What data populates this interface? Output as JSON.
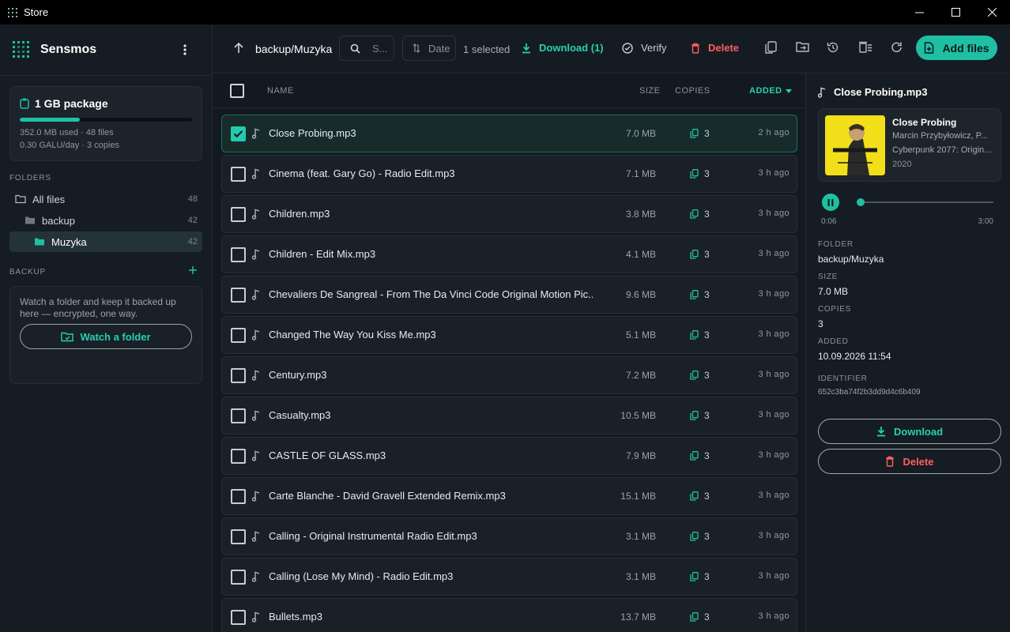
{
  "window": {
    "title": "Store"
  },
  "brand": {
    "name": "Sensmos"
  },
  "package": {
    "title": "1 GB package",
    "usage_fraction": 0.35,
    "usage_text": "352.0 MB used · 48 files",
    "rate_text": "0.30 GALU/day · 3 copies"
  },
  "sidebar": {
    "folders_label": "FOLDERS",
    "folders": [
      {
        "label": "All files",
        "count": "48"
      },
      {
        "label": "backup",
        "count": "42"
      },
      {
        "label": "Muzyka",
        "count": "42"
      }
    ],
    "backup_label": "BACKUP",
    "backup_text": "Watch a folder and keep it backed up here — encrypted, one way.",
    "watch_button": "Watch a folder"
  },
  "toolbar": {
    "path": "backup/Muzyka",
    "search_placeholder": "S...",
    "sort_label": "Date",
    "selected_text": "1 selected",
    "download_label": "Download (1)",
    "verify_label": "Verify",
    "delete_label": "Delete",
    "add_files_label": "Add files"
  },
  "columns": {
    "name": "NAME",
    "size": "SIZE",
    "copies": "COPIES",
    "added": "ADDED"
  },
  "files": [
    {
      "name": "Close Probing.mp3",
      "size": "7.0 MB",
      "copies": "3",
      "added": "2 h ago",
      "selected": true
    },
    {
      "name": "Cinema (feat. Gary Go) - Radio Edit.mp3",
      "size": "7.1 MB",
      "copies": "3",
      "added": "3 h ago"
    },
    {
      "name": "Children.mp3",
      "size": "3.8 MB",
      "copies": "3",
      "added": "3 h ago"
    },
    {
      "name": "Children - Edit Mix.mp3",
      "size": "4.1 MB",
      "copies": "3",
      "added": "3 h ago"
    },
    {
      "name": "Chevaliers De Sangreal - From The Da Vinci Code Original Motion Pic...",
      "size": "9.6 MB",
      "copies": "3",
      "added": "3 h ago"
    },
    {
      "name": "Changed The Way You Kiss Me.mp3",
      "size": "5.1 MB",
      "copies": "3",
      "added": "3 h ago"
    },
    {
      "name": "Century.mp3",
      "size": "7.2 MB",
      "copies": "3",
      "added": "3 h ago"
    },
    {
      "name": "Casualty.mp3",
      "size": "10.5 MB",
      "copies": "3",
      "added": "3 h ago"
    },
    {
      "name": "CASTLE OF GLASS.mp3",
      "size": "7.9 MB",
      "copies": "3",
      "added": "3 h ago"
    },
    {
      "name": "Carte Blanche - David Gravell Extended Remix.mp3",
      "size": "15.1 MB",
      "copies": "3",
      "added": "3 h ago"
    },
    {
      "name": "Calling - Original Instrumental Radio Edit.mp3",
      "size": "3.1 MB",
      "copies": "3",
      "added": "3 h ago"
    },
    {
      "name": "Calling (Lose My Mind) - Radio Edit.mp3",
      "size": "3.1 MB",
      "copies": "3",
      "added": "3 h ago"
    },
    {
      "name": "Bullets.mp3",
      "size": "13.7 MB",
      "copies": "3",
      "added": "3 h ago"
    }
  ],
  "detail": {
    "file_name": "Close Probing.mp3",
    "track_title": "Close Probing",
    "artist": "Marcin Przybyłowicz, P...",
    "album": "Cyberpunk 2077: Origin...",
    "year": "2020",
    "time_current": "0:06",
    "time_total": "3:00",
    "progress_fraction": 0.03,
    "folder_label": "FOLDER",
    "folder_value": "backup/Muzyka",
    "size_label": "SIZE",
    "size_value": "7.0 MB",
    "copies_label": "COPIES",
    "copies_value": "3",
    "added_label": "ADDED",
    "added_value": "10.09.2026 11:54",
    "identifier_label": "IDENTIFIER",
    "identifier_value": "652c3ba74f2b3dd9d4c6b409",
    "download_button": "Download",
    "delete_button": "Delete"
  },
  "colors": {
    "accent": "#1fbfa3",
    "danger": "#ff5f5f",
    "background": "#151b22"
  }
}
